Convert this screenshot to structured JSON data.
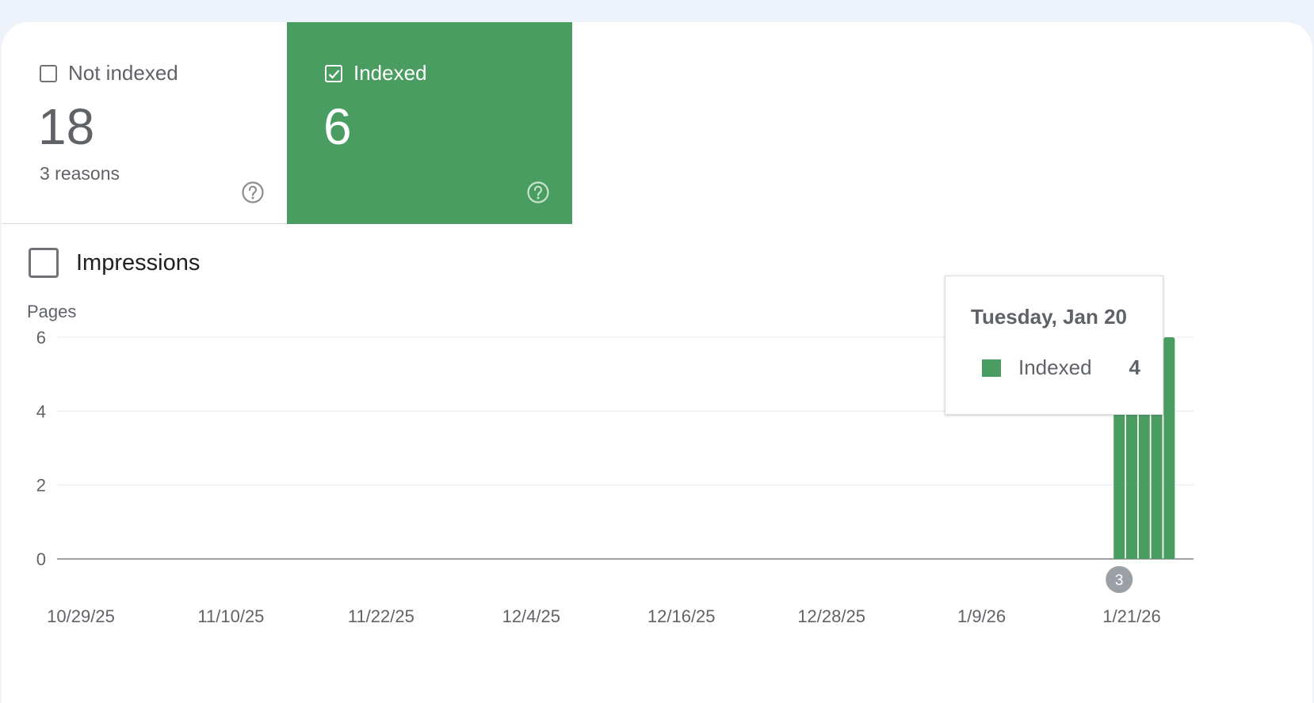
{
  "tiles": {
    "not_indexed": {
      "label": "Not indexed",
      "value": "18",
      "sub": "3 reasons",
      "checked": false
    },
    "indexed": {
      "label": "Indexed",
      "value": "6",
      "checked": true
    }
  },
  "impressions": {
    "label": "Impressions",
    "checked": false
  },
  "tooltip": {
    "title": "Tuesday, Jan 20",
    "series": "Indexed",
    "value": "4"
  },
  "annotation": {
    "label": "3"
  },
  "colors": {
    "indexed": "#4a9d61",
    "gridline": "#e8eaed",
    "axis": "#5f6368"
  },
  "chart_data": {
    "type": "bar",
    "ylabel": "Pages",
    "ylim": [
      0,
      6
    ],
    "yticks": [
      "0",
      "2",
      "4",
      "6"
    ],
    "x_tick_labels": [
      "10/29/25",
      "11/10/25",
      "11/22/25",
      "12/4/25",
      "12/16/25",
      "12/28/25",
      "1/9/26",
      "1/21/26"
    ],
    "series": [
      {
        "name": "Indexed",
        "points": [
          {
            "date": "1/20/26",
            "value": 4
          },
          {
            "date": "1/21/26",
            "value": 6
          },
          {
            "date": "1/22/26",
            "value": 6
          },
          {
            "date": "1/23/26",
            "value": 6
          },
          {
            "date": "1/24/26",
            "value": 6
          }
        ]
      }
    ],
    "legend": "none",
    "grid": true
  }
}
